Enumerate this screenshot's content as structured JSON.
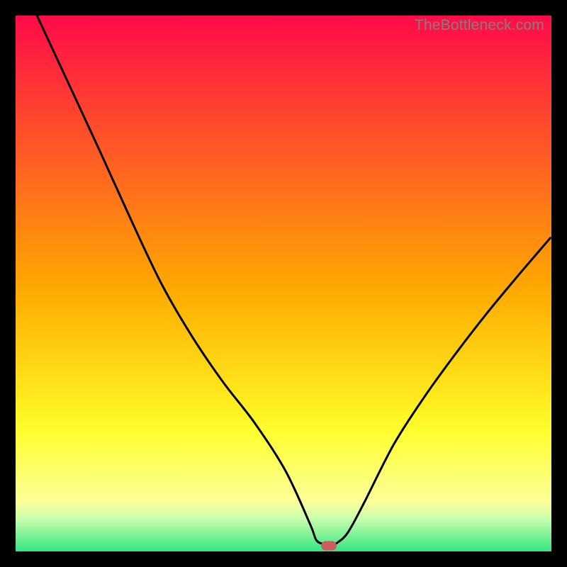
{
  "watermark": "TheBottleneck.com",
  "colors": {
    "page_bg": "#000000",
    "curve_stroke": "#000000",
    "marker_fill": "#cd5c5c",
    "watermark_fg": "#808080"
  },
  "chart_data": {
    "type": "line",
    "title": "",
    "xlabel": "",
    "ylabel": "",
    "xlim": [
      0,
      100
    ],
    "ylim": [
      0,
      100
    ],
    "series": [
      {
        "name": "bottleneck-curve",
        "x": [
          4.0,
          9.8,
          15.6,
          21.4,
          27.2,
          33.0,
          38.8,
          44.6,
          50.4,
          55.0,
          56.2,
          58.0,
          59.0,
          60.0,
          62.0,
          65.0,
          70.6,
          76.4,
          82.2,
          88.0,
          93.8,
          99.8
        ],
        "y": [
          100.0,
          87.5,
          75.0,
          62.2,
          50.0,
          40.0,
          31.5,
          24.0,
          15.0,
          5.0,
          2.0,
          1.3,
          1.2,
          1.6,
          3.5,
          9.0,
          20.0,
          29.0,
          37.0,
          44.5,
          51.5,
          58.5
        ]
      }
    ],
    "markers": [
      {
        "name": "bottleneck-point",
        "x": 58.5,
        "y": 1.1
      }
    ],
    "gradient_stops_pct_hex": [
      [
        0,
        "#ff0b49"
      ],
      [
        3.125,
        "#ff1544"
      ],
      [
        6.25,
        "#ff1e40"
      ],
      [
        9.375,
        "#ff283b"
      ],
      [
        12.5,
        "#ff3237"
      ],
      [
        15.625,
        "#ff3b33"
      ],
      [
        18.75,
        "#ff452e"
      ],
      [
        21.875,
        "#ff4f2a"
      ],
      [
        25,
        "#ff5826"
      ],
      [
        28.125,
        "#ff6221"
      ],
      [
        31.25,
        "#ff6c1d"
      ],
      [
        34.375,
        "#ff7519"
      ],
      [
        37.5,
        "#ff7f14"
      ],
      [
        40.625,
        "#ff8910"
      ],
      [
        43.75,
        "#ff920c"
      ],
      [
        46.875,
        "#ff9c07"
      ],
      [
        50,
        "#ffa603"
      ],
      [
        53.125,
        "#ffb003"
      ],
      [
        56.25,
        "#ffba08"
      ],
      [
        59.375,
        "#ffc40c"
      ],
      [
        62.5,
        "#ffce11"
      ],
      [
        65.625,
        "#ffd816"
      ],
      [
        68.75,
        "#ffe21a"
      ],
      [
        71.875,
        "#ffec1f"
      ],
      [
        75,
        "#fef625"
      ],
      [
        78.125,
        "#feff33"
      ],
      [
        81.25,
        "#fdff4c"
      ],
      [
        84.375,
        "#fdff66"
      ],
      [
        87.5,
        "#fcff80"
      ],
      [
        90.625,
        "#fcff99"
      ],
      [
        93.75,
        "#ccffad"
      ],
      [
        96.875,
        "#80f298"
      ],
      [
        100,
        "#33e683"
      ]
    ]
  }
}
